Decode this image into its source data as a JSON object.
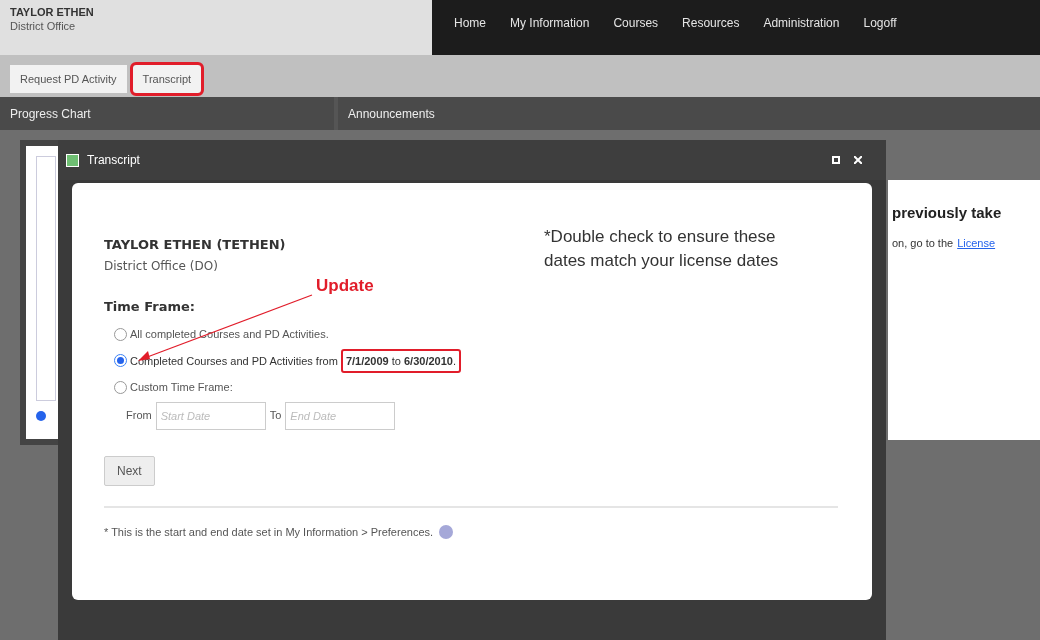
{
  "header": {
    "user_name": "TAYLOR ETHEN",
    "office": "District Office"
  },
  "nav": [
    "Home",
    "My Information",
    "Courses",
    "Resources",
    "Administration",
    "Logoff"
  ],
  "tabs": [
    {
      "label": "Request PD Activity",
      "selected": false
    },
    {
      "label": "Transcript",
      "selected": true
    }
  ],
  "panels": {
    "left_title": "Progress Chart",
    "right_title": "Announcements"
  },
  "announcement": {
    "heading": "previously take",
    "text": "on, go to the",
    "link": "License"
  },
  "dialog": {
    "title": "Transcript",
    "user": "TAYLOR ETHEN (TETHEN)",
    "office": "District Office (DO)",
    "note": "*Double check to ensure these dates match your license dates",
    "annotation": "Update",
    "time_frame_label": "Time Frame:",
    "options": [
      {
        "label": "All completed Courses and PD Activities.",
        "selected": false
      },
      {
        "label": "Completed Courses and PD Activities from",
        "dates": "**7/1/2009** to **6/30/2010**.",
        "selected": true
      },
      {
        "label": "Custom Time Frame:",
        "selected": false
      }
    ],
    "from_label": "From",
    "from_placeholder": "Start Date",
    "to_label": "To",
    "to_placeholder": "End Date",
    "next": "Next",
    "footnote": "* This is the start and end date set in My Information > Preferences."
  }
}
